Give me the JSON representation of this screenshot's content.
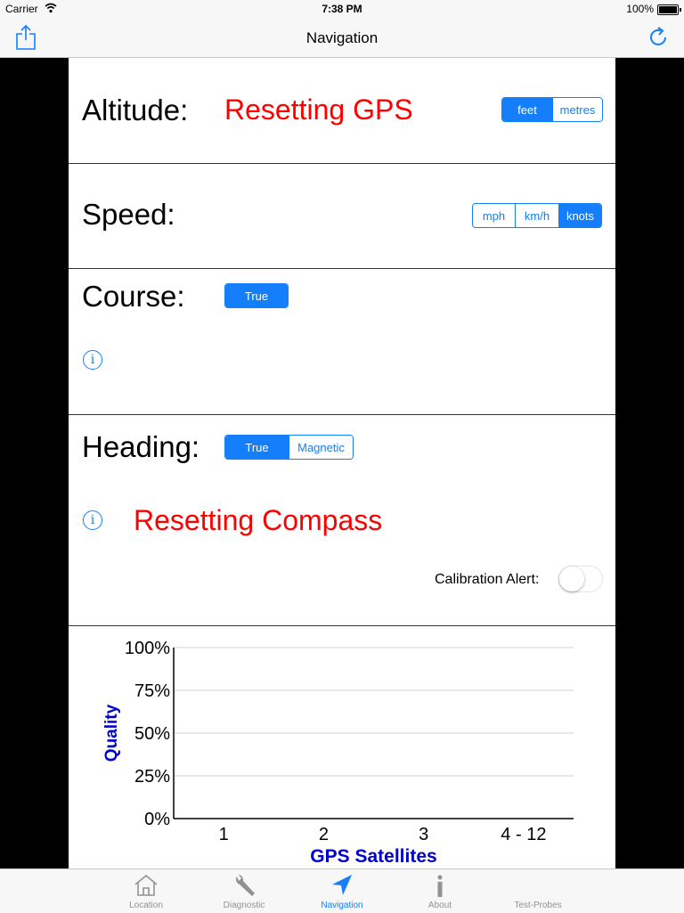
{
  "status_bar": {
    "carrier": "Carrier",
    "time": "7:38 PM",
    "battery": "100%"
  },
  "nav": {
    "title": "Navigation"
  },
  "altitude": {
    "label": "Altitude:",
    "value": "Resetting GPS",
    "units": [
      "feet",
      "metres"
    ],
    "selected": "feet"
  },
  "speed": {
    "label": "Speed:",
    "units": [
      "mph",
      "km/h",
      "knots"
    ],
    "selected": "knots"
  },
  "course": {
    "label": "Course:",
    "mode": "True"
  },
  "heading": {
    "label": "Heading:",
    "modes": [
      "True",
      "Magnetic"
    ],
    "selected": "True",
    "value": "Resetting Compass",
    "calibration_label": "Calibration Alert:",
    "calibration_on": false
  },
  "colors": {
    "accent": "#147efb",
    "alert": "#ff0000",
    "axis_title": "#0000cc"
  },
  "chart_data": {
    "type": "bar",
    "categories": [
      "1",
      "2",
      "3",
      "4 - 12"
    ],
    "values": [
      0,
      0,
      0,
      0
    ],
    "xlabel": "GPS Satellites",
    "ylabel": "Quality",
    "yticks": [
      "0%",
      "25%",
      "50%",
      "75%",
      "100%"
    ],
    "ylim": [
      0,
      100
    ],
    "grid": true
  },
  "tabs": [
    {
      "label": "Location",
      "icon": "house-icon",
      "active": false
    },
    {
      "label": "Diagnostic",
      "icon": "wrench-icon",
      "active": false
    },
    {
      "label": "Navigation",
      "icon": "location-arrow-icon",
      "active": true
    },
    {
      "label": "About",
      "icon": "info-icon",
      "active": false
    },
    {
      "label": "Test-Probes",
      "icon": "",
      "active": false
    }
  ]
}
